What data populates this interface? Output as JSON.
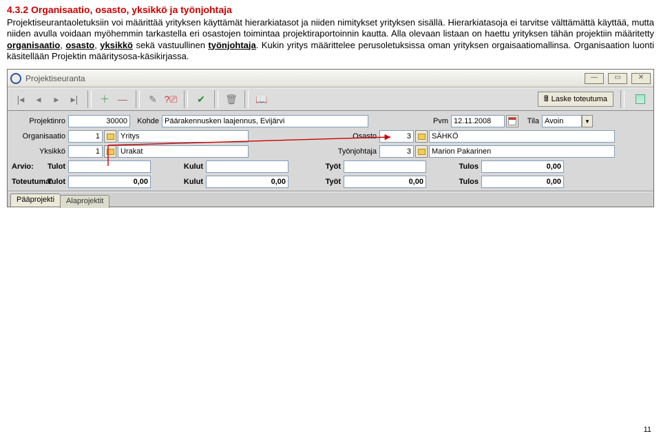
{
  "heading": "4.3.2 Organisaatio, osasto, yksikkö ja työnjohtaja",
  "para_parts": {
    "p1": "Projektiseurantaoletuksiin voi määrittää yrityksen käyttämät hierarkiatasot ja niiden nimitykset yrityksen sisällä. Hierarkiatasoja ei tarvitse välttämättä käyttää, mutta niiden avulla voidaan myöhemmin tarkastella eri osastojen toimintaa projektiraportoinnin kautta. Alla olevaan listaan on haettu yrityksen tähän projektiin määritetty ",
    "u1": "organisaatio",
    "c1": ", ",
    "u2": "osasto",
    "c2": ", ",
    "u3": "yksikkö",
    "p2": " sekä vastuullinen ",
    "u4": "työnjohtaja",
    "p3": ". Kukin yritys määrittelee perusoletuksissa oman yrityksen orgaisaatiomallinsa. Organisaation luonti käsitellään Projektin määritysosa-käsikirjassa."
  },
  "window_title": "Projektiseuranta",
  "toolbar": {
    "calc_label": "Laske toteutuma"
  },
  "form": {
    "projektinro": {
      "label": "Projektinro",
      "value": "30000"
    },
    "kohde": {
      "label": "Kohde",
      "value": "Päärakennusken laajennus, Evijärvi"
    },
    "pvm": {
      "label": "Pvm",
      "value": "12.11.2008"
    },
    "tila": {
      "label": "Tila",
      "value": "Avoin"
    },
    "organisaatio": {
      "label": "Organisaatio",
      "value": "1",
      "text": "Yritys"
    },
    "osasto": {
      "label": "Osasto",
      "value": "3",
      "text": "SÄHKÖ"
    },
    "yksikko": {
      "label": "Yksikkö",
      "value": "1",
      "text": "Urakat"
    },
    "tyonjohtaja": {
      "label": "Työnjohtaja",
      "value": "3",
      "text": "Marion Pakarinen"
    },
    "arvio": {
      "title": "Arvio:",
      "tulot": {
        "label": "Tulot",
        "value": ""
      },
      "kulut": {
        "label": "Kulut",
        "value": ""
      },
      "tyot": {
        "label": "Työt",
        "value": ""
      },
      "tulos": {
        "label": "Tulos",
        "value": "0,00"
      }
    },
    "toteutuma": {
      "title": "Toteutuma:",
      "tulot": {
        "label": "Tulot",
        "value": "0,00"
      },
      "kulut": {
        "label": "Kulut",
        "value": "0,00"
      },
      "tyot": {
        "label": "Työt",
        "value": "0,00"
      },
      "tulos": {
        "label": "Tulos",
        "value": "0,00"
      }
    }
  },
  "tabs": {
    "main": "Pääprojekti",
    "sub": "Alaprojektit"
  },
  "page_number": "11"
}
